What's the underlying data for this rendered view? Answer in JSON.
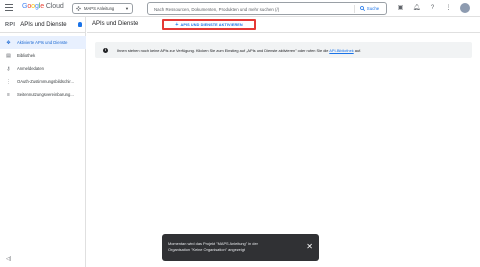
{
  "brand": {
    "google": "Google",
    "product": "Cloud"
  },
  "project": {
    "label": "MAPS Anleitung"
  },
  "search": {
    "placeholder": "Nach Ressourcen, Dokumenten, Produkten und mehr suchen (/)",
    "button_label": "Suche"
  },
  "sidebar": {
    "api_badge": "RPI",
    "title": "APIs und Dienste",
    "items": [
      {
        "label": "Aktivierte APIs und Dienste",
        "icon": "apps-icon",
        "active": true
      },
      {
        "label": "Bibliothek",
        "icon": "library-icon",
        "active": false
      },
      {
        "label": "Anmeldedaten",
        "icon": "key-icon",
        "active": false
      },
      {
        "label": "OAuth-Zustimmungsbildschir...",
        "icon": "consent-icon",
        "active": false
      },
      {
        "label": "Seitennutzungsvereinbarung...",
        "icon": "settings-list-icon",
        "active": false
      }
    ]
  },
  "header": {
    "title": "APIs und Dienste",
    "enable_label": "APIS UND DIENSTE AKTIVIEREN"
  },
  "info": {
    "text": "Ihnen stehen noch keine APIs zur Verfügung. Klicken Sie zum Einstieg auf „APIs und Dienste aktivieren\" oder rufen Sie die",
    "link": "API-Bibliothek",
    "suffix": "auf."
  },
  "snackbar": {
    "line1": "Momentan wird das Projekt \"MAPS Anleitung\" in der",
    "line2": "Organisation \"Keine Organisation\" angezeigt"
  },
  "colors": {
    "accent": "#1a73e8",
    "highlight_border": "#e53935",
    "active_bg": "#e8f0fe"
  }
}
